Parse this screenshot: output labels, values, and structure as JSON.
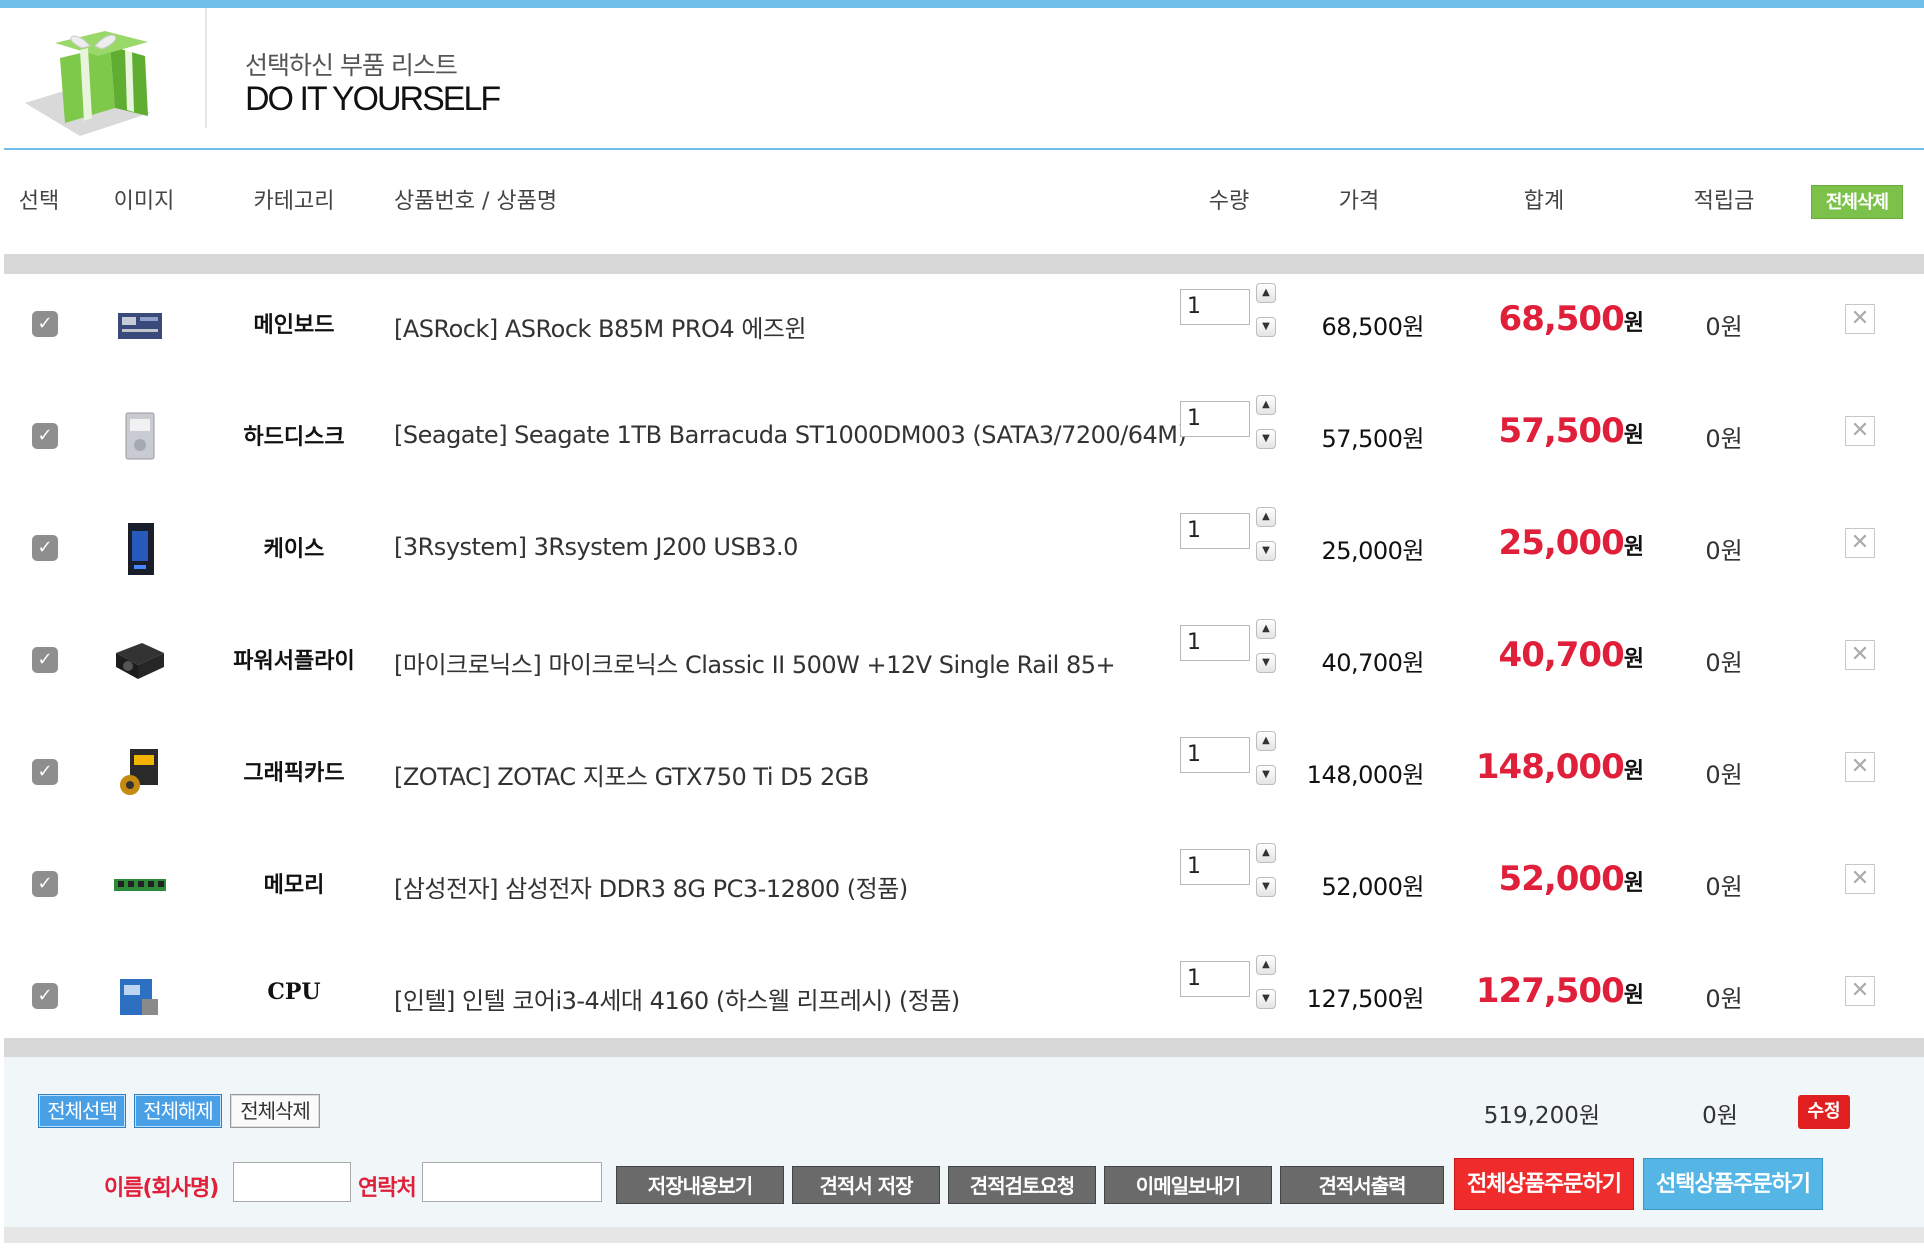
{
  "header": {
    "subtitle": "선택하신 부품 리스트",
    "title": "DO IT YOURSELF"
  },
  "columns": {
    "select": "선택",
    "image": "이미지",
    "category": "카테고리",
    "product": "상품번호 / 상품명",
    "qty": "수량",
    "price": "가격",
    "total": "합계",
    "points": "적립금",
    "delete_all": "전체삭제"
  },
  "items": [
    {
      "category": "메인보드",
      "name": "[ASRock] ASRock B85M PRO4 에즈윈",
      "qty": "1",
      "price": "68,500원",
      "total": "68,500",
      "unit": "원",
      "points": "0원",
      "thumb": "motherboard-thumb"
    },
    {
      "category": "하드디스크",
      "name": "[Seagate] Seagate 1TB Barracuda ST1000DM003 (SATA3/7200/64M)",
      "qty": "1",
      "price": "57,500원",
      "total": "57,500",
      "unit": "원",
      "points": "0원",
      "thumb": "hdd-thumb"
    },
    {
      "category": "케이스",
      "name": "[3Rsystem] 3Rsystem J200 USB3.0",
      "qty": "1",
      "price": "25,000원",
      "total": "25,000",
      "unit": "원",
      "points": "0원",
      "thumb": "case-thumb"
    },
    {
      "category": "파워서플라이",
      "name": "[마이크로닉스] 마이크로닉스 Classic II 500W +12V Single Rail 85+",
      "qty": "1",
      "price": "40,700원",
      "total": "40,700",
      "unit": "원",
      "points": "0원",
      "thumb": "psu-thumb"
    },
    {
      "category": "그래픽카드",
      "name": "[ZOTAC] ZOTAC 지포스 GTX750 Ti D5 2GB",
      "qty": "1",
      "price": "148,000원",
      "total": "148,000",
      "unit": "원",
      "points": "0원",
      "thumb": "gpu-thumb"
    },
    {
      "category": "메모리",
      "name": "[삼성전자] 삼성전자 DDR3 8G PC3-12800 (정품)",
      "qty": "1",
      "price": "52,000원",
      "total": "52,000",
      "unit": "원",
      "points": "0원",
      "thumb": "ram-thumb"
    },
    {
      "category": "CPU",
      "name": "[인텔] 인텔 코어i3-4세대 4160 (하스웰 리프레시) (정품)",
      "qty": "1",
      "price": "127,500원",
      "total": "127,500",
      "unit": "원",
      "points": "0원",
      "thumb": "cpu-thumb"
    }
  ],
  "footer": {
    "select_all": "전체선택",
    "deselect_all": "전체해제",
    "delete_all": "전체삭제",
    "sum_total": "519,200원",
    "sum_points": "0원",
    "edit": "수정",
    "name_label": "이름(회사명)",
    "contact_label": "연락처",
    "view_saved": "저장내용보기",
    "save_quote": "견적서 저장",
    "request_review": "견적검토요청",
    "send_email": "이메일보내기",
    "print_quote": "견적서출력",
    "order_all": "전체상품주문하기",
    "order_selected": "선택상품주문하기"
  },
  "colors": {
    "accent_blue": "#6fbfea",
    "total_red": "#e0203a",
    "green_button": "#7cc24a"
  }
}
